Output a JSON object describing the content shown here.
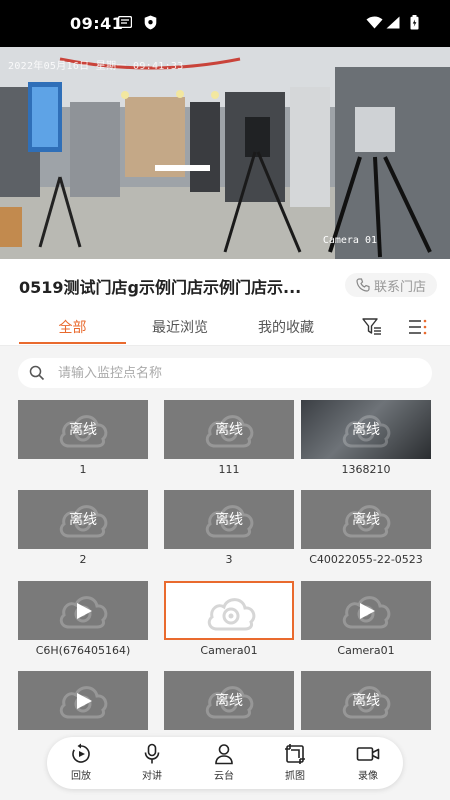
{
  "status_bar": {
    "time": "09:41"
  },
  "video": {
    "timestamp": "2022年05月16日 星期一 09:41:33",
    "camera_label": "Camera 01"
  },
  "store": {
    "name": "0519测试门店g示例门店示例门店示...",
    "contact_label": "联系门店"
  },
  "tabs": [
    {
      "label": "全部",
      "active": true
    },
    {
      "label": "最近浏览",
      "active": false
    },
    {
      "label": "我的收藏",
      "active": false
    }
  ],
  "search": {
    "placeholder": "请输入监控点名称"
  },
  "offline_text": "离线",
  "tiles": [
    {
      "name": "1",
      "state": "offline"
    },
    {
      "name": "111",
      "state": "offline"
    },
    {
      "name": "1368210",
      "state": "offline_preview"
    },
    {
      "name": "2",
      "state": "offline"
    },
    {
      "name": "3",
      "state": "offline"
    },
    {
      "name": "C40022055-22-0523",
      "state": "offline"
    },
    {
      "name": "C6H(676405164)",
      "state": "play"
    },
    {
      "name": "Camera01",
      "state": "selected"
    },
    {
      "name": "Camera01",
      "state": "play"
    },
    {
      "name": "",
      "state": "play"
    },
    {
      "name": "",
      "state": "offline"
    },
    {
      "name": "",
      "state": "offline"
    }
  ],
  "toolbar": [
    {
      "label": "回放",
      "icon": "playback-icon"
    },
    {
      "label": "对讲",
      "icon": "microphone-icon"
    },
    {
      "label": "云台",
      "icon": "ptz-icon"
    },
    {
      "label": "抓图",
      "icon": "snapshot-icon"
    },
    {
      "label": "录像",
      "icon": "record-icon"
    }
  ],
  "colors": {
    "accent": "#e96a2e",
    "tile_bg": "#7a7a7a",
    "grid_bg": "#f4f4f4"
  }
}
